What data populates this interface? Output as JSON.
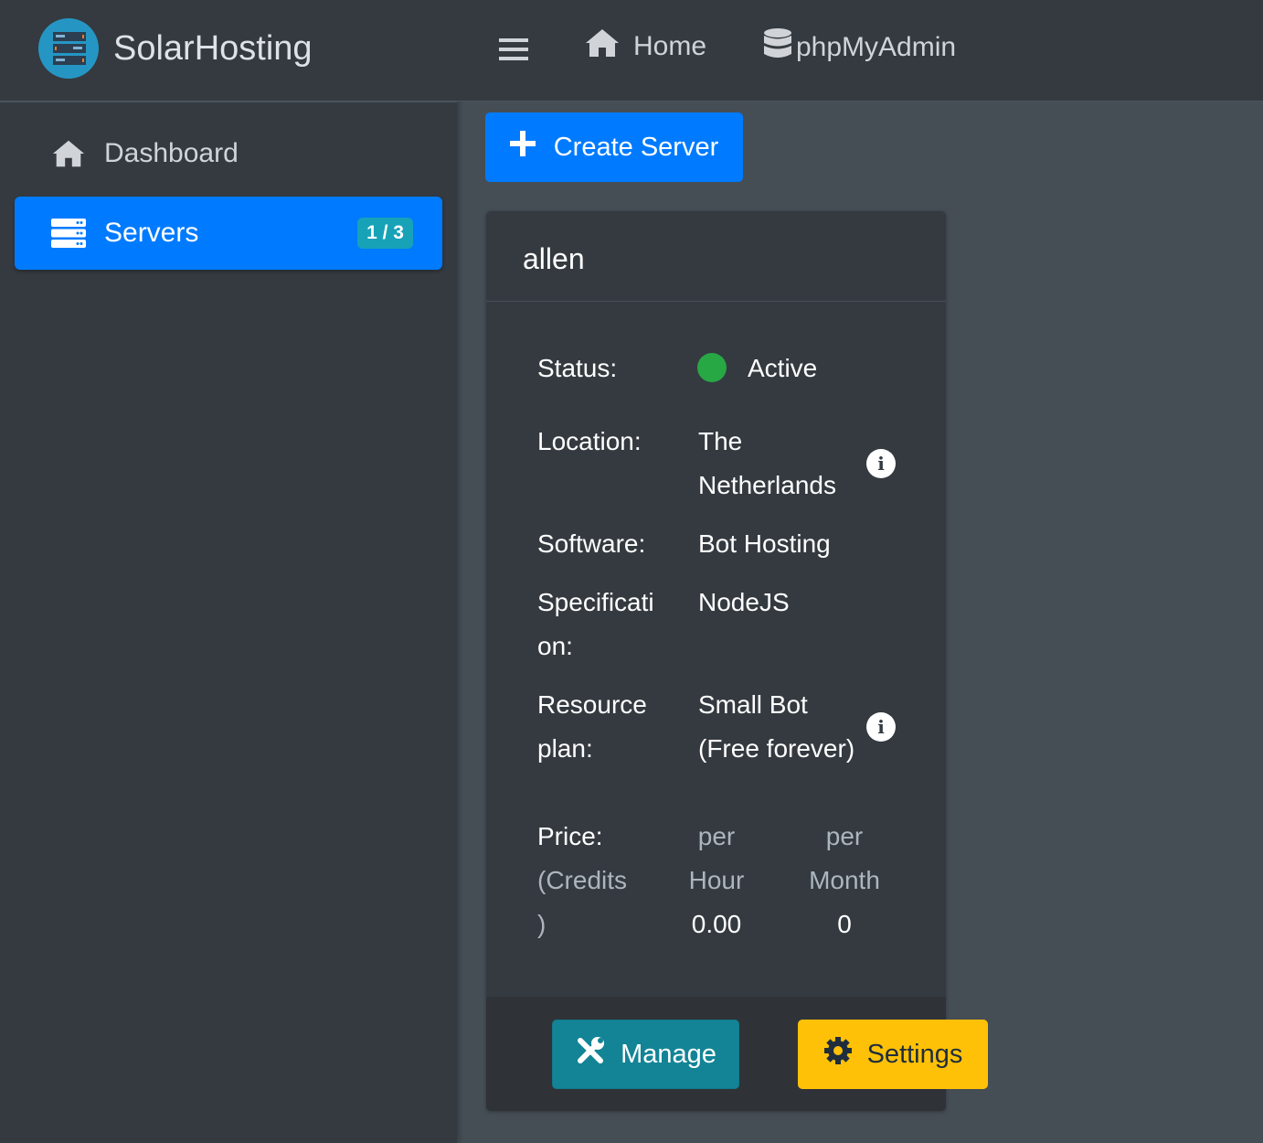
{
  "brand": {
    "name": "SolarHosting"
  },
  "sidebar": {
    "items": [
      {
        "label": "Dashboard",
        "icon": "home-icon"
      },
      {
        "label": "Servers",
        "icon": "server-icon",
        "badge": "1 / 3",
        "active": true
      }
    ]
  },
  "topbar": {
    "links": [
      {
        "label": "Home",
        "icon": "home-icon"
      },
      {
        "label": "phpMyAdmin",
        "icon": "database-icon"
      }
    ]
  },
  "actions": {
    "create_server": "Create Server"
  },
  "server": {
    "name": "allen",
    "status_label": "Status:",
    "status": "Active",
    "status_color": "#28a745",
    "location_label": "Location:",
    "location_line1": "The",
    "location_line2": "Netherlands",
    "software_label": "Software:",
    "software": "Bot Hosting",
    "spec_label_1": "Specificati",
    "spec_label_2": "on:",
    "spec": "NodeJS",
    "plan_label_1": "Resource",
    "plan_label_2": "plan:",
    "plan_line1": "Small Bot",
    "plan_line2": "(Free forever)",
    "price_label": "Price:",
    "price_unit_1": "(Credits",
    "price_unit_2": ")",
    "per_hour_1": "per",
    "per_hour_2": "Hour",
    "per_month_1": "per",
    "per_month_2": "Month",
    "price_hour": "0.00",
    "price_month": "0",
    "manage": "Manage",
    "settings": "Settings"
  }
}
